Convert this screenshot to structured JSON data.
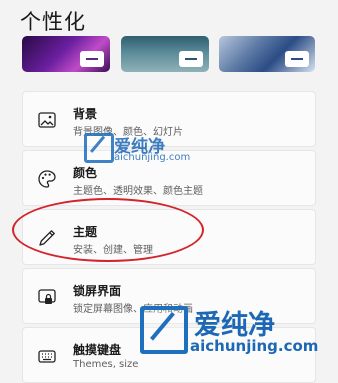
{
  "page": {
    "title": "个性化"
  },
  "themes": [
    {
      "name": "theme-purple"
    },
    {
      "name": "theme-lake"
    },
    {
      "name": "theme-bloom"
    }
  ],
  "settings": [
    {
      "id": "background",
      "label": "背景",
      "desc": "背景图像、颜色、幻灯片",
      "icon": "image-icon"
    },
    {
      "id": "colors",
      "label": "颜色",
      "desc": "主题色、透明效果、颜色主题",
      "icon": "palette-icon"
    },
    {
      "id": "themes",
      "label": "主题",
      "desc": "安装、创建、管理",
      "icon": "pen-icon"
    },
    {
      "id": "lockscreen",
      "label": "锁屏界面",
      "desc": "锁定屏幕图像、应用和动画",
      "icon": "lock-screen-icon"
    },
    {
      "id": "touchkeyboard",
      "label": "触摸键盘",
      "desc": "Themes, size",
      "icon": "keyboard-icon"
    }
  ],
  "watermark": {
    "brand": "爱纯净",
    "site": "aichunjing.com"
  },
  "colors": {
    "highlight": "#d3242c",
    "watermark": "#1d68b5"
  }
}
